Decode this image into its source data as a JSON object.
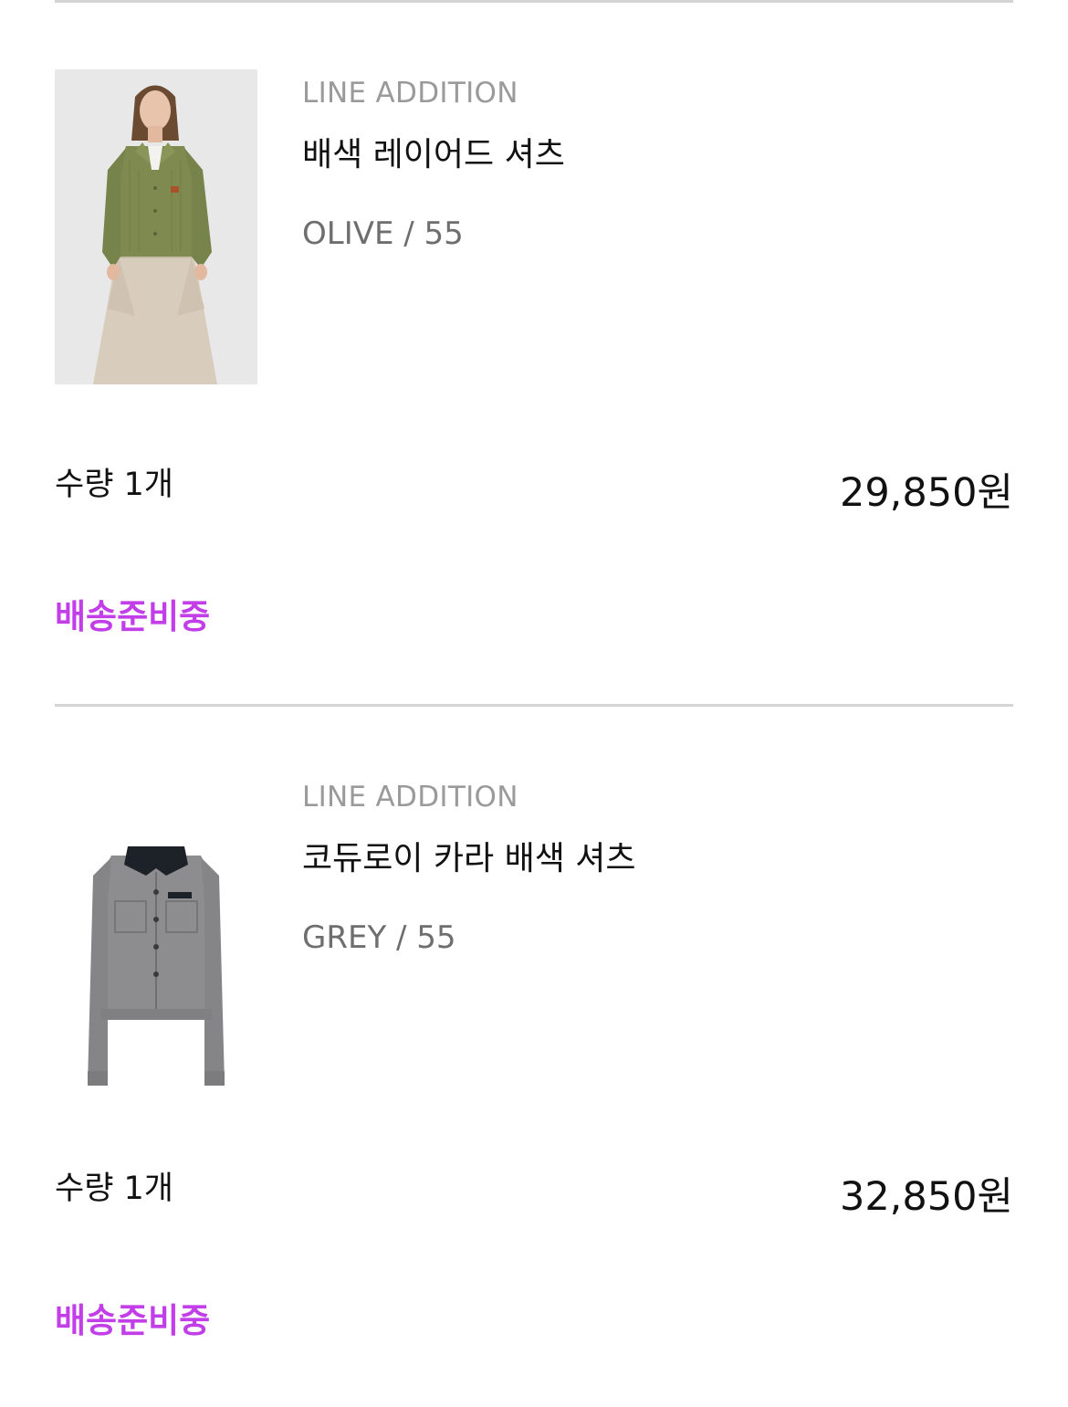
{
  "accent_color": "#c23ee8",
  "orders": [
    {
      "brand": "LINE ADDITION",
      "name": "배색 레이어드 셔츠",
      "option": "OLIVE / 55",
      "quantity_label": "수량 1개",
      "price": "29,850원",
      "status": "배송준비중",
      "image_icon": "model-photo-olive-shirt"
    },
    {
      "brand": "LINE ADDITION",
      "name": "코듀로이 카라 배색 셔츠",
      "option": "GREY / 55",
      "quantity_label": "수량 1개",
      "price": "32,850원",
      "status": "배송준비중",
      "image_icon": "grey-jacket-photo"
    }
  ]
}
